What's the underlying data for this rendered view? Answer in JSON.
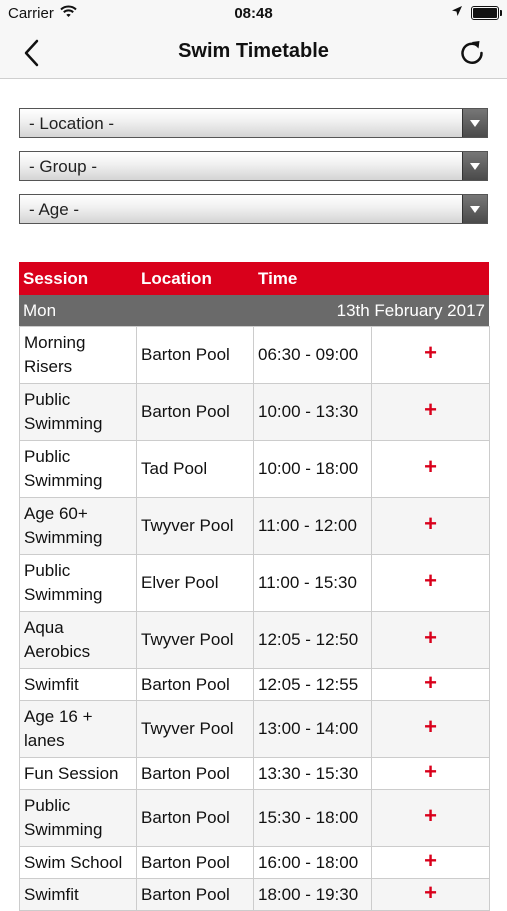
{
  "status": {
    "carrier": "Carrier",
    "time": "08:48"
  },
  "nav": {
    "title": "Swim Timetable"
  },
  "filters": {
    "location": "- Location -",
    "group": "- Group -",
    "age": "- Age -"
  },
  "table": {
    "headers": {
      "session": "Session",
      "location": "Location",
      "time": "Time"
    },
    "day": "Mon",
    "date": "13th February 2017",
    "add_symbol": "+",
    "rows": [
      {
        "session": "Morning Risers",
        "location": "Barton Pool",
        "time": "06:30 - 09:00"
      },
      {
        "session": "Public Swimming",
        "location": "Barton Pool",
        "time": "10:00 - 13:30"
      },
      {
        "session": "Public Swimming",
        "location": "Tad Pool",
        "time": "10:00 - 18:00"
      },
      {
        "session": "Age 60+ Swimming",
        "location": "Twyver Pool",
        "time": "11:00 - 12:00"
      },
      {
        "session": "Public Swimming",
        "location": "Elver Pool",
        "time": "11:00 - 15:30"
      },
      {
        "session": "Aqua Aerobics",
        "location": "Twyver Pool",
        "time": "12:05 - 12:50"
      },
      {
        "session": "Swimfit",
        "location": "Barton Pool",
        "time": "12:05 - 12:55"
      },
      {
        "session": "Age 16 + lanes",
        "location": "Twyver Pool",
        "time": "13:00 - 14:00"
      },
      {
        "session": "Fun Session",
        "location": "Barton Pool",
        "time": "13:30 - 15:30"
      },
      {
        "session": "Public Swimming",
        "location": "Barton Pool",
        "time": "15:30 - 18:00"
      },
      {
        "session": "Swim School",
        "location": "Barton Pool",
        "time": "16:00 - 18:00"
      },
      {
        "session": "Swimfit",
        "location": "Barton Pool",
        "time": "18:00 - 19:30"
      }
    ]
  }
}
